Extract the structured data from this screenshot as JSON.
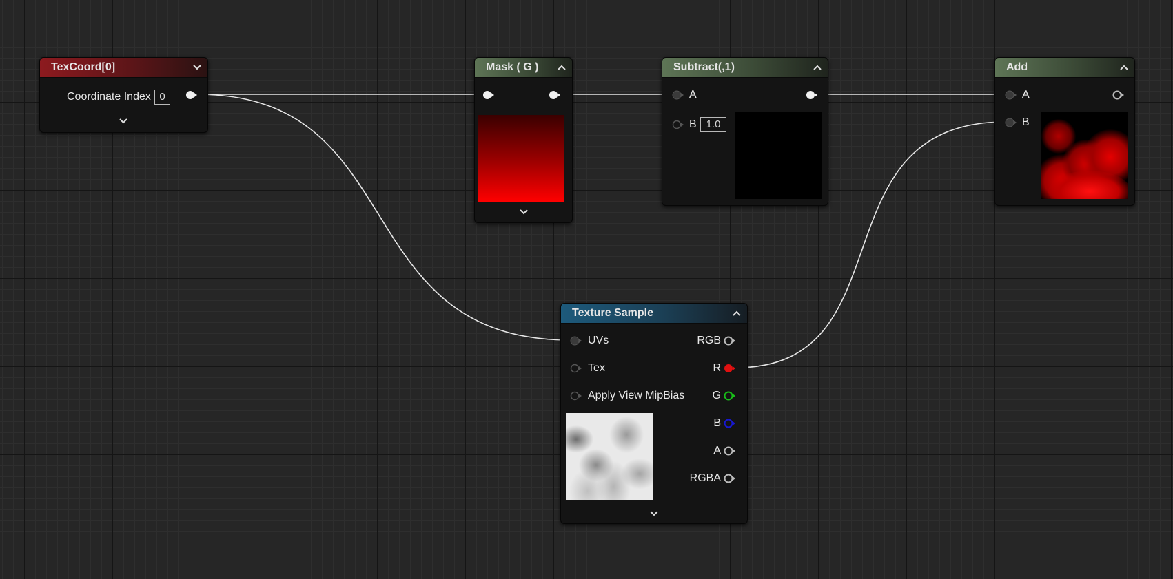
{
  "nodes": {
    "texcoord": {
      "title": "TexCoord[0]",
      "param_label": "Coordinate Index",
      "param_value": "0"
    },
    "mask": {
      "title": "Mask ( G )"
    },
    "subtract": {
      "title": "Subtract(,1)",
      "pin_a": "A",
      "pin_b": "B",
      "b_value": "1.0"
    },
    "add": {
      "title": "Add",
      "pin_a": "A",
      "pin_b": "B"
    },
    "texture_sample": {
      "title": "Texture Sample",
      "inputs": [
        "UVs",
        "Tex",
        "Apply View MipBias"
      ],
      "outputs": [
        "RGB",
        "R",
        "G",
        "B",
        "A",
        "RGBA"
      ]
    }
  },
  "colors": {
    "header_red": "#8d1a1f",
    "header_green": "#5e7556",
    "header_blue": "#1d5a7c",
    "wire": "#e6e6e6",
    "pin_r": "#e01010",
    "pin_g": "#18c018",
    "pin_b": "#1818d0"
  },
  "icons": [
    "chevron-down-icon",
    "chevron-up-icon",
    "pin-icon"
  ]
}
